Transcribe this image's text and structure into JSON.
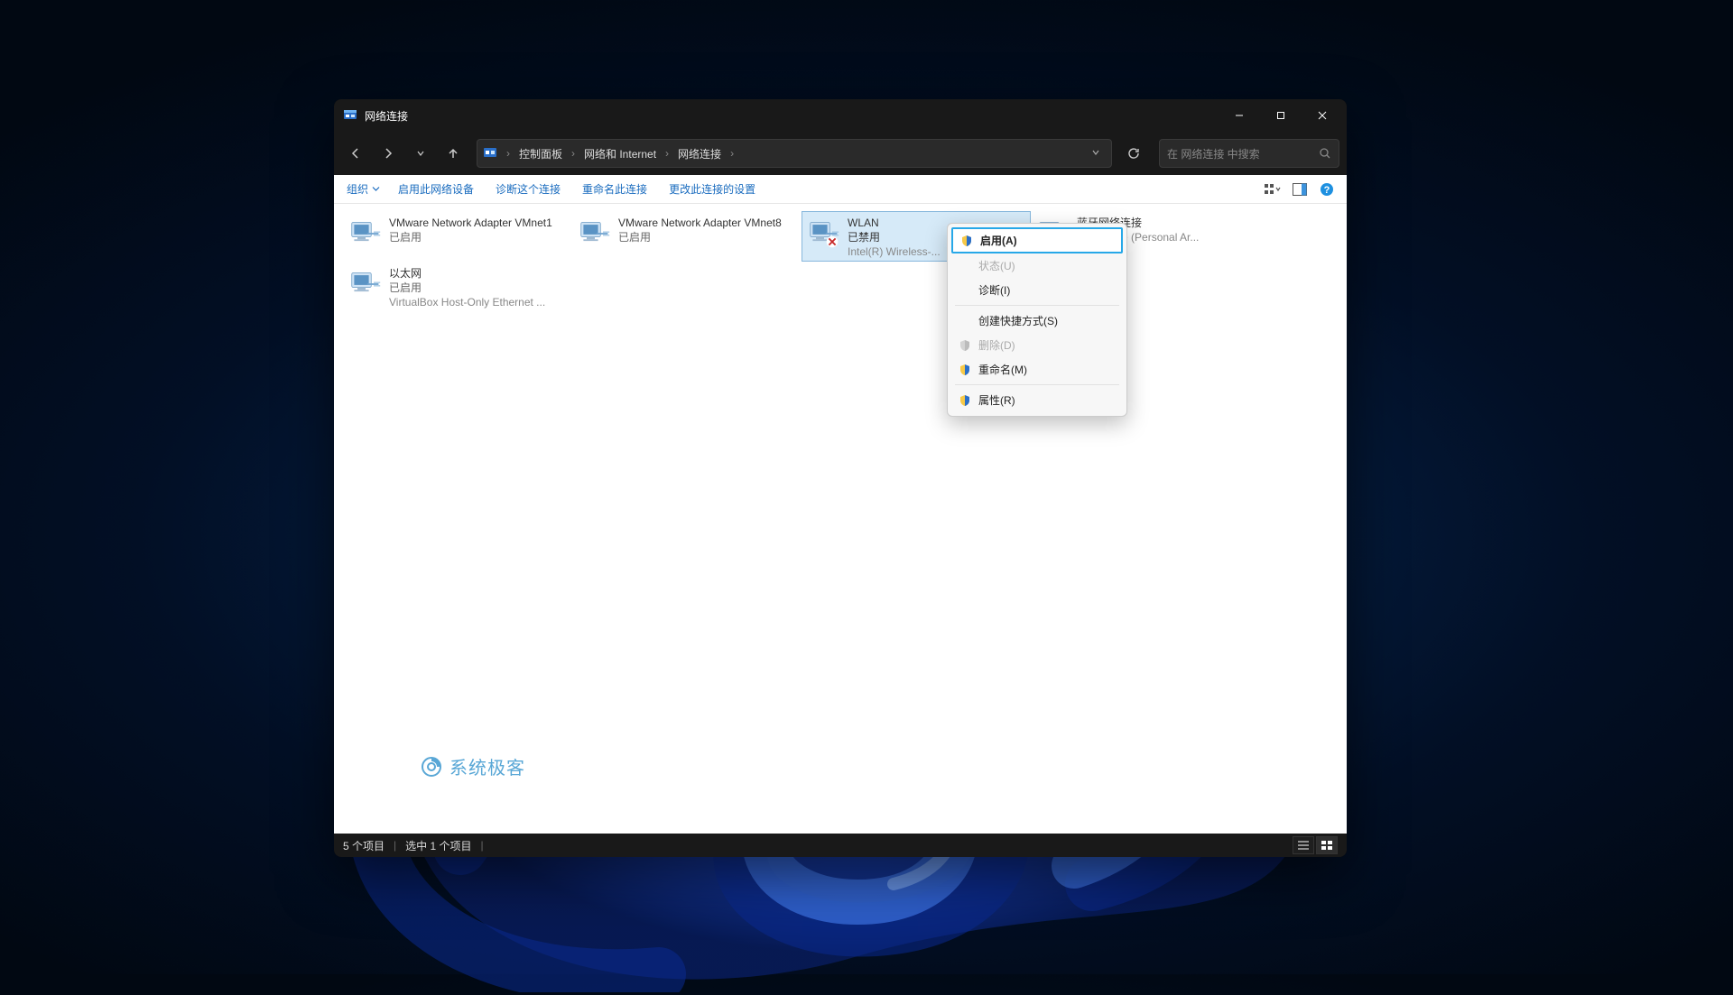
{
  "window": {
    "title": "网络连接"
  },
  "breadcrumbs": {
    "root": "控制面板",
    "mid": "网络和 Internet",
    "leaf": "网络连接"
  },
  "search": {
    "placeholder": "在 网络连接 中搜索"
  },
  "toolbar": {
    "organize": "组织",
    "items": [
      "启用此网络设备",
      "诊断这个连接",
      "重命名此连接",
      "更改此连接的设置"
    ]
  },
  "adapters": [
    {
      "name": "VMware Network Adapter VMnet1",
      "status": "已启用",
      "device": "",
      "state": "enabled"
    },
    {
      "name": "VMware Network Adapter VMnet8",
      "status": "已启用",
      "device": "",
      "state": "enabled"
    },
    {
      "name": "WLAN",
      "status": "已禁用",
      "device": "Intel(R) Wireless-...",
      "state": "disabled",
      "selected": true
    },
    {
      "name": "蓝牙网络连接",
      "status": "",
      "device": "...h Device (Personal Ar...",
      "state": "enabled"
    },
    {
      "name": "以太网",
      "status": "已启用",
      "device": "VirtualBox Host-Only Ethernet ...",
      "state": "enabled"
    }
  ],
  "context_menu": [
    {
      "label": "启用(A)",
      "shield": true,
      "highlight": true
    },
    {
      "label": "状态(U)",
      "disabled": true
    },
    {
      "label": "诊断(I)"
    },
    {
      "sep": true
    },
    {
      "label": "创建快捷方式(S)"
    },
    {
      "label": "删除(D)",
      "shield": true,
      "disabled": true
    },
    {
      "label": "重命名(M)",
      "shield": true
    },
    {
      "sep": true
    },
    {
      "label": "属性(R)",
      "shield": true
    }
  ],
  "statusbar": {
    "count": "5 个项目",
    "selection": "选中 1 个项目"
  },
  "watermark": "系统极客"
}
